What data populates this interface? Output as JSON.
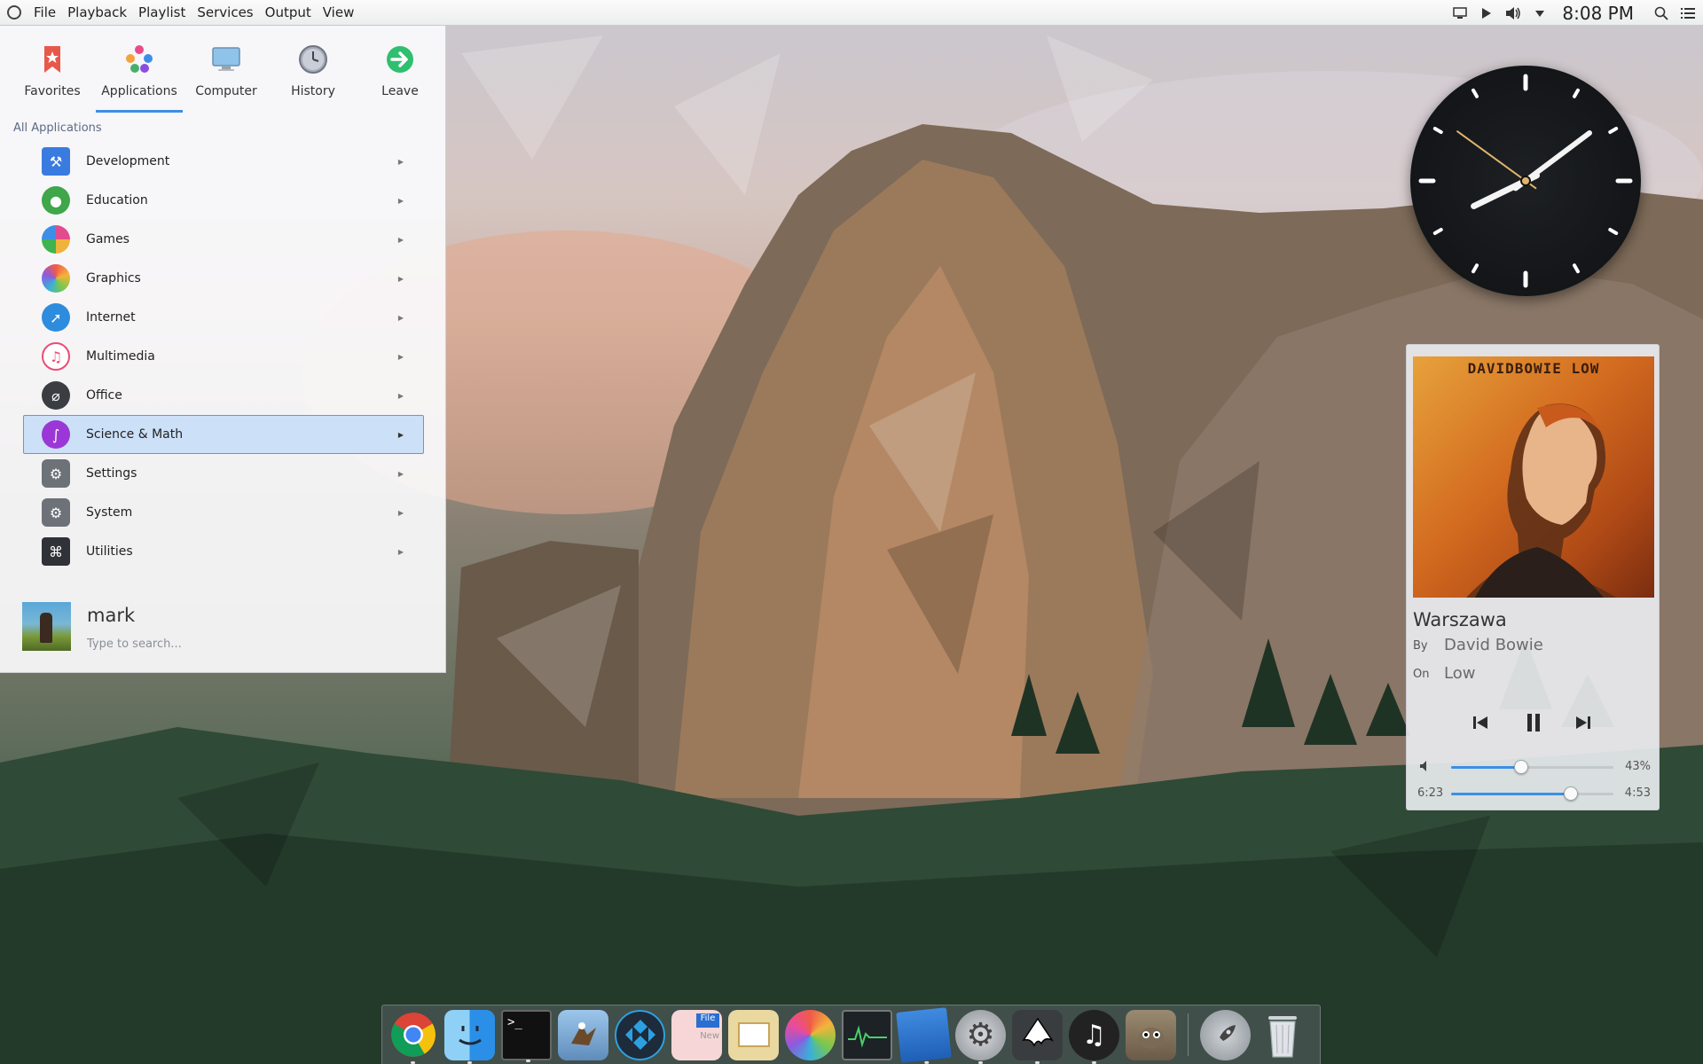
{
  "menubar": {
    "menus": [
      {
        "label": "File",
        "name": "menu-file"
      },
      {
        "label": "Playback",
        "name": "menu-playback"
      },
      {
        "label": "Playlist",
        "name": "menu-playlist"
      },
      {
        "label": "Services",
        "name": "menu-services"
      },
      {
        "label": "Output",
        "name": "menu-output"
      },
      {
        "label": "View",
        "name": "menu-view"
      }
    ],
    "time": "8:08 PM",
    "tray_icons": [
      "display-icon",
      "play-icon",
      "volume-icon",
      "dropdown-arrow-icon",
      "search-icon",
      "list-icon"
    ]
  },
  "launcher": {
    "tabs": [
      {
        "label": "Favorites",
        "icon": "bookmark-star-icon",
        "active": false
      },
      {
        "label": "Applications",
        "icon": "apps-dots-icon",
        "active": true
      },
      {
        "label": "Computer",
        "icon": "monitor-icon",
        "active": false
      },
      {
        "label": "History",
        "icon": "clock-icon",
        "active": false
      },
      {
        "label": "Leave",
        "icon": "arrow-right-circle-icon",
        "active": false
      }
    ],
    "section_title": "All Applications",
    "categories": [
      {
        "label": "Development",
        "icon": "development-icon",
        "color": "#3a7be0"
      },
      {
        "label": "Education",
        "icon": "apple-icon",
        "color": "#3fa64a"
      },
      {
        "label": "Games",
        "icon": "games-icon",
        "color": "#e24b8c"
      },
      {
        "label": "Graphics",
        "icon": "photos-flower-icon",
        "color": "#f0a63a"
      },
      {
        "label": "Internet",
        "icon": "compass-icon",
        "color": "#2d8cde"
      },
      {
        "label": "Multimedia",
        "icon": "music-note-icon",
        "color": "#e94c78"
      },
      {
        "label": "Office",
        "icon": "paperclip-icon",
        "color": "#3a3d42"
      },
      {
        "label": "Science & Math",
        "icon": "dna-icon",
        "color": "#9b37d6",
        "selected": true
      },
      {
        "label": "Settings",
        "icon": "settings-gear-icon",
        "color": "#6d7278"
      },
      {
        "label": "System",
        "icon": "system-gear-icon",
        "color": "#6d7278"
      },
      {
        "label": "Utilities",
        "icon": "command-key-icon",
        "color": "#2f3236"
      }
    ],
    "user_name": "mark",
    "search_placeholder": "Type to search..."
  },
  "player": {
    "cover_text": "DAVIDBOWIE LOW",
    "track": "Warszawa",
    "by_label": "By",
    "artist": "David Bowie",
    "on_label": "On",
    "album": "Low",
    "volume_percent": 43,
    "volume_label": "43%",
    "elapsed": "6:23",
    "remaining": "4:53",
    "progress_fraction": 0.74
  },
  "clock": {
    "hours": 8,
    "minutes": 8,
    "seconds": 51
  },
  "dock": {
    "items": [
      {
        "name": "chrome-icon",
        "running": true
      },
      {
        "name": "finder-icon",
        "running": true
      },
      {
        "name": "terminal-icon",
        "running": true
      },
      {
        "name": "mail-eagle-icon",
        "running": false
      },
      {
        "name": "kodi-icon",
        "running": false
      },
      {
        "name": "file-manager-icon",
        "running": false
      },
      {
        "name": "preview-icon",
        "running": false
      },
      {
        "name": "photos-icon",
        "running": false
      },
      {
        "name": "activity-monitor-icon",
        "running": false
      },
      {
        "name": "text-editor-icon",
        "running": true
      },
      {
        "name": "system-preferences-icon",
        "running": true
      },
      {
        "name": "inkscape-icon",
        "running": true
      },
      {
        "name": "music-player-icon",
        "running": true
      },
      {
        "name": "gimp-icon",
        "running": false
      },
      {
        "name": "launchpad-rocket-icon",
        "running": false
      },
      {
        "name": "trash-icon",
        "running": false
      }
    ]
  },
  "colors": {
    "accent": "#3d8ee6",
    "selection_bg": "#c8def8"
  }
}
